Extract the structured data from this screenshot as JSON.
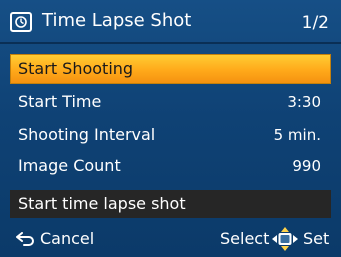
{
  "header": {
    "icon": "time-lapse-mode-icon",
    "title": "Time Lapse Shot",
    "page": "1/2"
  },
  "menu": {
    "items": [
      {
        "label": "Start Shooting",
        "value": "",
        "selected": true
      },
      {
        "label": "Start Time",
        "value": "3:30"
      },
      {
        "label": "Shooting Interval",
        "value": "5 min."
      },
      {
        "label": "Image Count",
        "value": "990"
      }
    ]
  },
  "help": {
    "text": "Start time lapse shot"
  },
  "footer": {
    "cancel_icon": "back-arrow-icon",
    "cancel_label": "Cancel",
    "select_label": "Select",
    "dpad_icon": "dpad-icon",
    "set_label": "Set"
  },
  "colors": {
    "background": "#0f4275",
    "selected": "#ffa91a",
    "help_bar": "#262626",
    "text": "#ffffff"
  }
}
